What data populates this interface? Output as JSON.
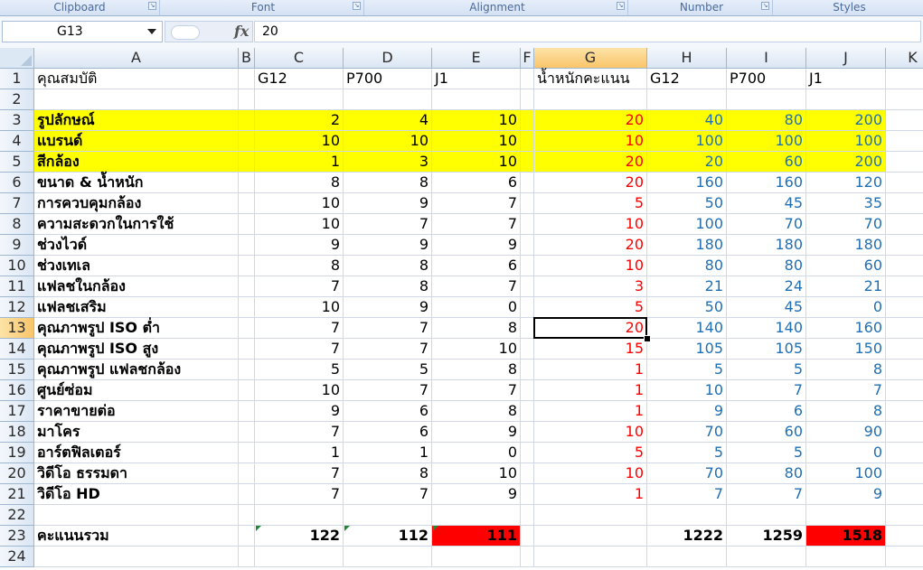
{
  "ribbon": {
    "groups": [
      "Clipboard",
      "Font",
      "Alignment",
      "Number",
      "Styles"
    ]
  },
  "formula_bar": {
    "name_box": "G13",
    "fx": "fx",
    "content": "20"
  },
  "columns": [
    "A",
    "B",
    "C",
    "D",
    "E",
    "F",
    "G",
    "H",
    "I",
    "J",
    "K"
  ],
  "selected_column": "G",
  "selected_row": 13,
  "rows": [
    {
      "n": 1,
      "label": "คุณสมบัติ",
      "c": "G12",
      "d": "P700",
      "e": "J1",
      "g": "น้ำหนักคะแนน",
      "h": "G12",
      "i": "P700",
      "j": "J1"
    },
    {
      "n": 2,
      "label": "",
      "c": "",
      "d": "",
      "e": "",
      "g": "",
      "h": "",
      "i": "",
      "j": ""
    },
    {
      "n": 3,
      "label": "รูปลักษณ์",
      "c": "2",
      "d": "4",
      "e": "10",
      "g": "20",
      "h": "40",
      "i": "80",
      "j": "200"
    },
    {
      "n": 4,
      "label": "แบรนด์",
      "c": "10",
      "d": "10",
      "e": "10",
      "g": "10",
      "h": "100",
      "i": "100",
      "j": "100"
    },
    {
      "n": 5,
      "label": "สีกล้อง",
      "c": "1",
      "d": "3",
      "e": "10",
      "g": "20",
      "h": "20",
      "i": "60",
      "j": "200"
    },
    {
      "n": 6,
      "label": "ขนาด & น้ำหนัก",
      "c": "8",
      "d": "8",
      "e": "6",
      "g": "20",
      "h": "160",
      "i": "160",
      "j": "120"
    },
    {
      "n": 7,
      "label": "การควบคุมกล้อง",
      "c": "10",
      "d": "9",
      "e": "7",
      "g": "5",
      "h": "50",
      "i": "45",
      "j": "35"
    },
    {
      "n": 8,
      "label": "ความสะดวกในการใช้",
      "c": "10",
      "d": "7",
      "e": "7",
      "g": "10",
      "h": "100",
      "i": "70",
      "j": "70"
    },
    {
      "n": 9,
      "label": "ช่วงไวด์",
      "c": "9",
      "d": "9",
      "e": "9",
      "g": "20",
      "h": "180",
      "i": "180",
      "j": "180"
    },
    {
      "n": 10,
      "label": "ช่วงเทเล",
      "c": "8",
      "d": "8",
      "e": "6",
      "g": "10",
      "h": "80",
      "i": "80",
      "j": "60"
    },
    {
      "n": 11,
      "label": "แฟลชในกล้อง",
      "c": "7",
      "d": "8",
      "e": "7",
      "g": "3",
      "h": "21",
      "i": "24",
      "j": "21"
    },
    {
      "n": 12,
      "label": "แฟลชเสริม",
      "c": "10",
      "d": "9",
      "e": "0",
      "g": "5",
      "h": "50",
      "i": "45",
      "j": "0"
    },
    {
      "n": 13,
      "label": "คุณภาพรูป ISO ต่ำ",
      "c": "7",
      "d": "7",
      "e": "8",
      "g": "20",
      "h": "140",
      "i": "140",
      "j": "160"
    },
    {
      "n": 14,
      "label": "คุณภาพรูป ISO สูง",
      "c": "7",
      "d": "7",
      "e": "10",
      "g": "15",
      "h": "105",
      "i": "105",
      "j": "150"
    },
    {
      "n": 15,
      "label": "คุณภาพรูป แฟลชกล้อง",
      "c": "5",
      "d": "5",
      "e": "8",
      "g": "1",
      "h": "5",
      "i": "5",
      "j": "8"
    },
    {
      "n": 16,
      "label": "ศูนย์ซ่อม",
      "c": "10",
      "d": "7",
      "e": "7",
      "g": "1",
      "h": "10",
      "i": "7",
      "j": "7"
    },
    {
      "n": 17,
      "label": "ราคาขายต่อ",
      "c": "9",
      "d": "6",
      "e": "8",
      "g": "1",
      "h": "9",
      "i": "6",
      "j": "8"
    },
    {
      "n": 18,
      "label": "มาโคร",
      "c": "7",
      "d": "6",
      "e": "9",
      "g": "10",
      "h": "70",
      "i": "60",
      "j": "90"
    },
    {
      "n": 19,
      "label": "อาร์ตฟิลเตอร์",
      "c": "1",
      "d": "1",
      "e": "0",
      "g": "5",
      "h": "5",
      "i": "5",
      "j": "0"
    },
    {
      "n": 20,
      "label": "วิดีโอ ธรรมดา",
      "c": "7",
      "d": "8",
      "e": "10",
      "g": "10",
      "h": "70",
      "i": "80",
      "j": "100"
    },
    {
      "n": 21,
      "label": "วิดีโอ HD",
      "c": "7",
      "d": "7",
      "e": "9",
      "g": "1",
      "h": "7",
      "i": "7",
      "j": "9"
    },
    {
      "n": 22,
      "label": "",
      "c": "",
      "d": "",
      "e": "",
      "g": "",
      "h": "",
      "i": "",
      "j": ""
    },
    {
      "n": 23,
      "label": "คะแนนรวม",
      "c": "122",
      "d": "112",
      "e": "111",
      "g": "",
      "h": "1222",
      "i": "1259",
      "j": "1518"
    },
    {
      "n": 24,
      "label": "",
      "c": "",
      "d": "",
      "e": "",
      "g": "",
      "h": "",
      "i": "",
      "j": ""
    }
  ],
  "colors": {
    "highlight_yellow": "#ffff00",
    "highlight_red": "#ff0000",
    "weight_text": "#ff0000",
    "result_text": "#1f6fb4",
    "selection_header": "#f9c56a"
  }
}
